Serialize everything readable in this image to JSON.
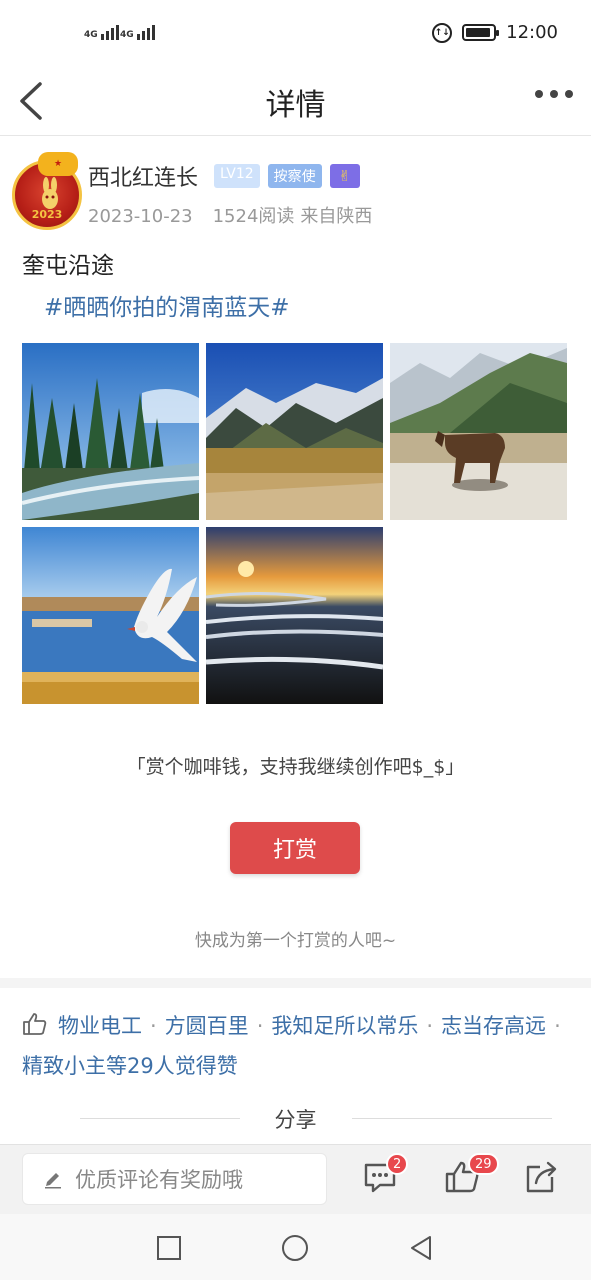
{
  "status_bar": {
    "signal1_label": "4G",
    "signal2_label": "4G",
    "time": "12:00"
  },
  "nav": {
    "title": "详情",
    "back_icon": "chevron-left-icon",
    "more_icon": "more-dots-icon"
  },
  "post": {
    "author": {
      "name": "西北红连长",
      "level": "LV12",
      "role": "按察使",
      "emoji_badge": "✌",
      "avatar_year": "2023"
    },
    "date": "2023-10-23",
    "reads": "1524阅读",
    "source": "来自陕西",
    "title": "奎屯沿途",
    "hashtag": "#晒晒你拍的渭南蓝天#",
    "images": [
      {
        "name": "forest-river-photo"
      },
      {
        "name": "mountain-valley-photo"
      },
      {
        "name": "cow-grassland-photo"
      },
      {
        "name": "seagull-lake-photo"
      },
      {
        "name": "sunset-river-photo"
      }
    ]
  },
  "reward": {
    "prompt": "「赏个咖啡钱，支持我继续创作吧$_$」",
    "button_label": "打赏",
    "hint": "快成为第一个打赏的人吧~"
  },
  "likes": {
    "users": [
      "物业电工",
      "方圆百里",
      "我知足所以常乐",
      "志当存高远",
      "精致小主"
    ],
    "suffix": "等29人觉得赞"
  },
  "share": {
    "label": "分享"
  },
  "bottom_bar": {
    "comment_placeholder": "优质评论有奖励哦",
    "comment_count": "2",
    "like_count": "29"
  },
  "colors": {
    "accent_red": "#de4b4b",
    "link_blue": "#3d6fa7",
    "badge_red": "#e8484d"
  }
}
